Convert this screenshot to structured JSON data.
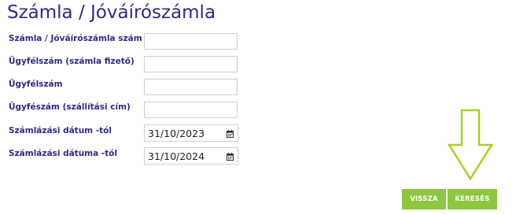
{
  "page": {
    "title": "Számla / Jóváírószámla"
  },
  "form": {
    "fields": [
      {
        "label": "Számla / Jóváírószámla szám",
        "value": ""
      },
      {
        "label": "Ügyfélszám (számla fizető)",
        "value": ""
      },
      {
        "label": "Ügyfélszám",
        "value": ""
      },
      {
        "label": "Ügyfészám (szállítási cím)",
        "value": ""
      }
    ],
    "date_fields": [
      {
        "label": "Számlázási dátum -tól",
        "value": "31/10/2023",
        "icon": "calendar-icon"
      },
      {
        "label": "Számlázási dátuma -tól",
        "value": "31/10/2024",
        "icon": "calendar-icon"
      }
    ]
  },
  "actions": {
    "back_label": "VISSZA",
    "search_label": "KERESÉS"
  },
  "colors": {
    "heading": "#2b2b86",
    "button": "#8dc63f",
    "arrow_annotation": "#a6d21e",
    "input_border": "#cfcfcf"
  },
  "annotation": {
    "icon": "down-arrow-icon"
  }
}
